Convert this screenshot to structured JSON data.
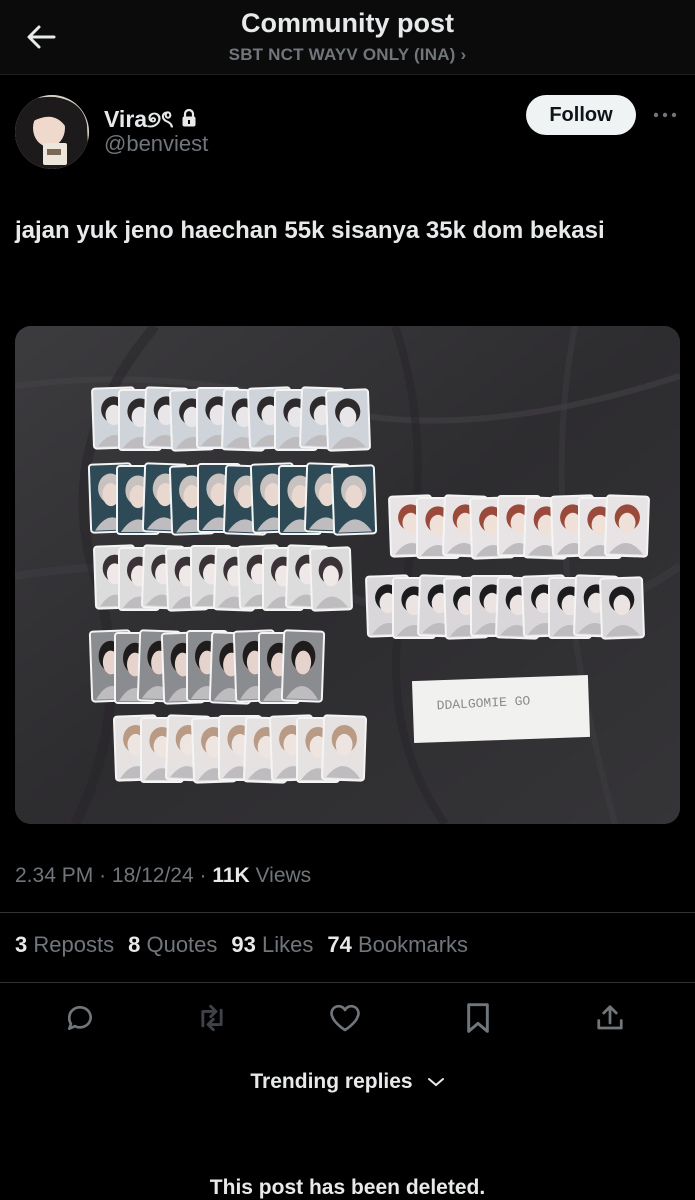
{
  "header": {
    "title": "Community post",
    "community": "SBT NCT WAYV ONLY (INA) ›"
  },
  "author": {
    "name": "Vira୭ৎ",
    "handle": "@benviest",
    "locked": true,
    "follow_label": "Follow"
  },
  "post": {
    "text": "jajan yuk jeno haechan 55k sisanya 35k dom bekasi",
    "media_envelope_text": "DDALGOMIE GO"
  },
  "meta": {
    "time": "2.34 PM",
    "date": "18/12/24",
    "views_count": "11K",
    "views_label": "Views"
  },
  "stats": {
    "reposts_count": "3",
    "reposts_label": "Reposts",
    "quotes_count": "8",
    "quotes_label": "Quotes",
    "likes_count": "93",
    "likes_label": "Likes",
    "bookmarks_count": "74",
    "bookmarks_label": "Bookmarks"
  },
  "actions": [
    "reply-icon",
    "repost-icon",
    "like-icon",
    "bookmark-icon",
    "share-icon"
  ],
  "trending": {
    "label": "Trending replies"
  },
  "deleted_reply": {
    "text": "This post has been deleted."
  },
  "colors": {
    "background": "#000000",
    "text": "#e7e9ea",
    "muted": "#71767b",
    "follow_bg": "#eff3f4"
  }
}
